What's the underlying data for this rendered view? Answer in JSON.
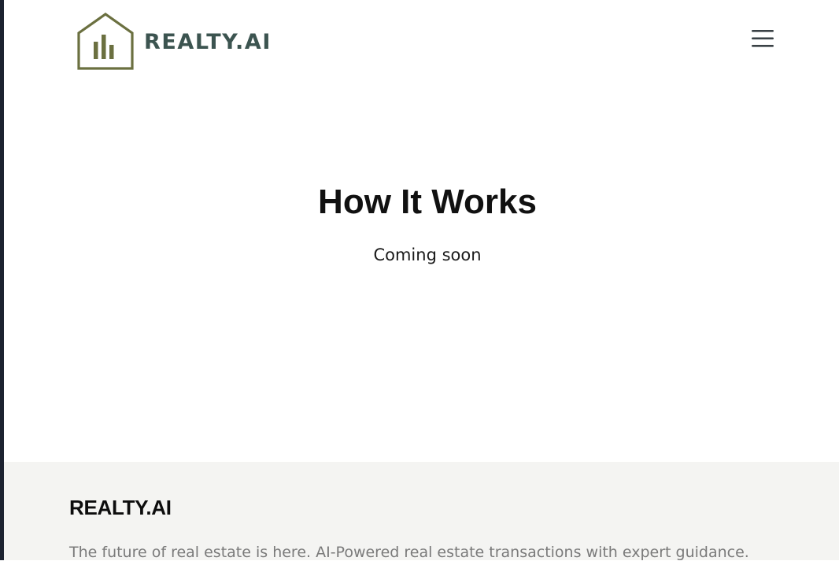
{
  "header": {
    "brand": "REALTY.AI",
    "menu_icon": "hamburger-menu-icon",
    "logo_icon": "house-chart-icon"
  },
  "hero": {
    "title": "How It Works",
    "subtitle": "Coming soon"
  },
  "footer": {
    "brand": "REALTY.AI",
    "tagline": "The future of real estate is here. AI-Powered real estate transactions with expert guidance."
  },
  "colors": {
    "brand_text": "#3c5450",
    "logo_mark": "#6b7040",
    "footer_bg": "#f4f4f2",
    "tagline_text": "#7a7a7a"
  }
}
